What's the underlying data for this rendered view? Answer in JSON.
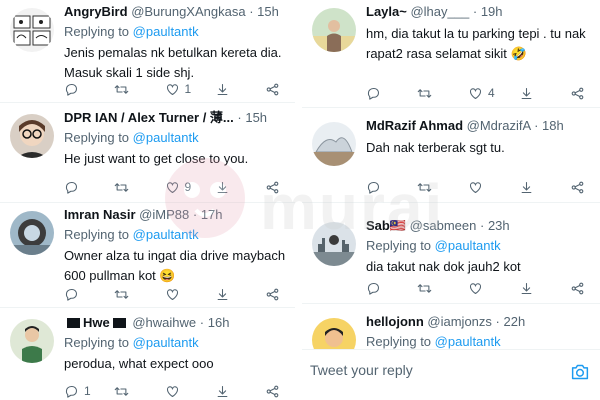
{
  "left": {
    "tweets": [
      {
        "name": "AngryBird",
        "handle": "@BurungXAngkasa",
        "time": "15h",
        "replying_prefix": "Replying to",
        "replying_to": "@paultantk",
        "text": "Jenis pemalas nk betulkan kereta dia. Masuk skali 1 side shj.",
        "likes": "1",
        "retweets": "",
        "replies": ""
      },
      {
        "name": "DPR IAN / Alex Turner / 薄...",
        "handle": "",
        "time": "15h",
        "replying_prefix": "Replying to",
        "replying_to": "@paultantk",
        "text": "He just want to get close to you.",
        "likes": "9",
        "retweets": "",
        "replies": ""
      },
      {
        "name": "Imran Nasir",
        "handle": "@iMP88",
        "time": "17h",
        "replying_prefix": "Replying to",
        "replying_to": "@paultantk",
        "text": "Owner alza tu ingat dia drive maybach 600 pullman kot 😆",
        "likes": "",
        "retweets": "",
        "replies": ""
      },
      {
        "name": "Hwe",
        "handle": "@hwaihwe",
        "time": "16h",
        "replying_prefix": "Replying to",
        "replying_to": "@paultantk",
        "text": "perodua, what expect ooo",
        "likes": "",
        "retweets": "",
        "replies": "1"
      }
    ]
  },
  "right": {
    "tweets": [
      {
        "name": "Layla~",
        "handle": "@lhay___",
        "time": "19h",
        "replying_prefix": "Replying to",
        "replying_to": "@paultantk",
        "text": "hm, dia takut la tu parking tepi . tu nak rapat2 rasa selamat sikit 🤣",
        "likes": "4",
        "retweets": "",
        "replies": ""
      },
      {
        "name": "MdRazif Ahmad",
        "handle": "@MdrazifA",
        "time": "18h",
        "replying_prefix": "Replying to",
        "replying_to": "@paultantk",
        "text": "Dah nak terberak sgt tu.",
        "likes": "",
        "retweets": "",
        "replies": ""
      },
      {
        "name": "Sab🇲🇾",
        "handle": "@sabmeen",
        "time": "23h",
        "replying_prefix": "Replying to",
        "replying_to": "@paultantk",
        "text": "dia takut nak dok jauh2 kot",
        "likes": "",
        "retweets": "",
        "replies": ""
      },
      {
        "name": "hellojonn",
        "handle": "@iamjonzs",
        "time": "22h",
        "replying_prefix": "Replying to",
        "replying_to": "@paultantk",
        "text": "",
        "likes": "",
        "retweets": "",
        "replies": ""
      }
    ],
    "compose_placeholder": "Tweet your reply"
  },
  "watermark": {
    "text": "murai"
  },
  "icons": [
    "reply-icon",
    "retweet-icon",
    "like-icon",
    "bookmark-icon",
    "share-icon",
    "camera-icon"
  ],
  "colors": {
    "link": "#1d9bf0",
    "muted": "#536471",
    "text": "#0f1419",
    "divider": "#eff3f4"
  }
}
